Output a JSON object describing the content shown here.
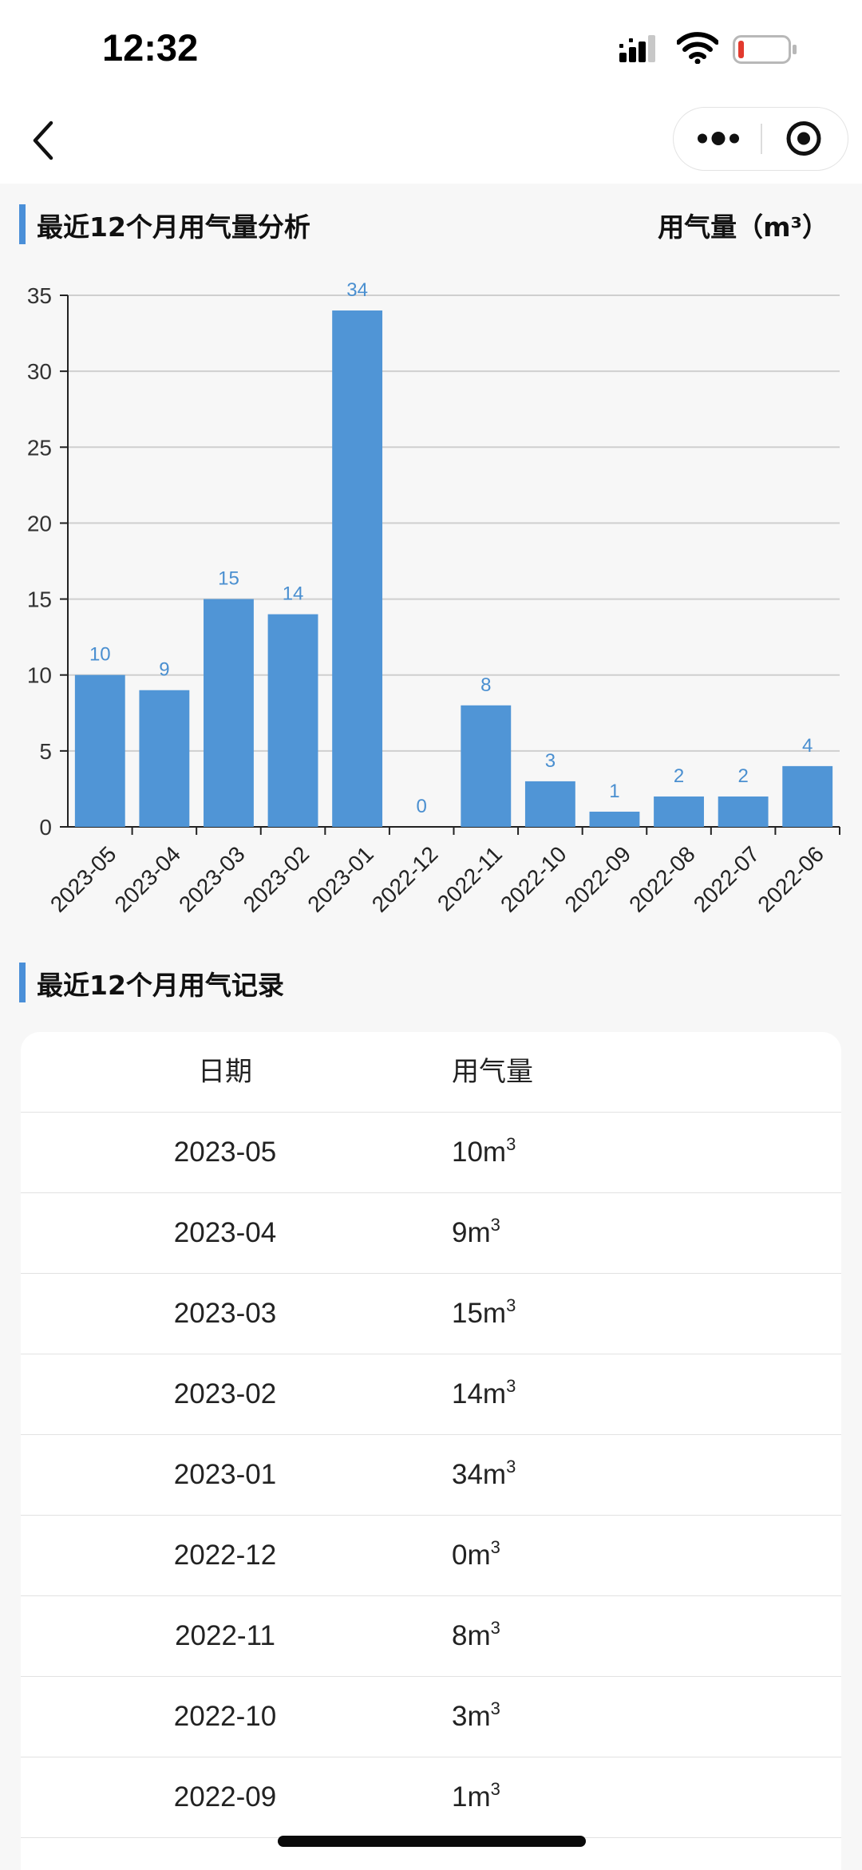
{
  "status_bar": {
    "time": "12:32",
    "signal_icon": "cellular-signal-icon",
    "wifi_icon": "wifi-icon",
    "battery_icon": "battery-low-icon",
    "battery_level": 0.12
  },
  "nav": {
    "back_icon": "chevron-left-icon",
    "more_icon": "more-dots-icon",
    "close_icon": "target-circle-icon"
  },
  "analysis": {
    "title": "最近12个月用气量分析",
    "unit": "用气量（m³）"
  },
  "chart_data": {
    "type": "bar",
    "title": "最近12个月用气量分析",
    "ylabel": "用气量（m³）",
    "categories": [
      "2023-05",
      "2023-04",
      "2023-03",
      "2023-02",
      "2023-01",
      "2022-12",
      "2022-11",
      "2022-10",
      "2022-09",
      "2022-08",
      "2022-07",
      "2022-06"
    ],
    "values": [
      10,
      9,
      15,
      14,
      34,
      0,
      8,
      3,
      1,
      2,
      2,
      4
    ],
    "ylim": [
      0,
      35
    ],
    "yticks": [
      0,
      5,
      10,
      15,
      20,
      25,
      30,
      35
    ],
    "grid": true,
    "data_labels": true,
    "bar_color": "#5095d6",
    "label_color": "#4a8fd0"
  },
  "records": {
    "title": "最近12个月用气记录",
    "headers": {
      "date": "日期",
      "usage": "用气量"
    },
    "unit": "m",
    "unit_sup": "3",
    "rows": [
      {
        "date": "2023-05",
        "usage": "10"
      },
      {
        "date": "2023-04",
        "usage": "9"
      },
      {
        "date": "2023-03",
        "usage": "15"
      },
      {
        "date": "2023-02",
        "usage": "14"
      },
      {
        "date": "2023-01",
        "usage": "34"
      },
      {
        "date": "2022-12",
        "usage": "0"
      },
      {
        "date": "2022-11",
        "usage": "8"
      },
      {
        "date": "2022-10",
        "usage": "3"
      },
      {
        "date": "2022-09",
        "usage": "1"
      }
    ]
  },
  "colors": {
    "accent": "#4a8fd8",
    "page_background": "#f7f7f7"
  }
}
